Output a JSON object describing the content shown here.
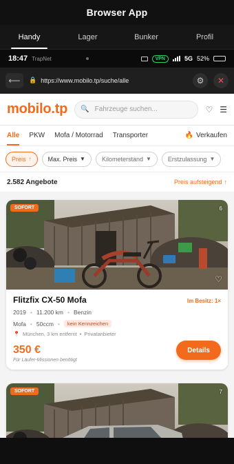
{
  "app": {
    "title": "Browser App",
    "tabs": [
      "Handy",
      "Lager",
      "Bunker",
      "Profil"
    ]
  },
  "status": {
    "time": "18:47",
    "carrier": "TrapNet",
    "vpn": "VPN",
    "network": "5G",
    "battery": "52%",
    "battery_level": 0.52
  },
  "browser": {
    "url": "https://www.mobilo.tp/suche/alle"
  },
  "site": {
    "logo": "mobilo",
    "logo_tld": ".tp",
    "search_placeholder": "Fahrzeuge suchen...",
    "categories": [
      "Alle",
      "PKW",
      "Mofa / Motorrad",
      "Transporter",
      "Verkaufen"
    ],
    "filters": [
      "Preis",
      "Max. Preis",
      "Kilometerstand",
      "Erstzulassung"
    ],
    "result_count": "2.582 Angebote",
    "sort_label": "Preis aufsteigend",
    "listings": [
      {
        "badge": "SOFORT",
        "photo_count": "6",
        "title": "Flitzfix CX-50 Mofa",
        "ownership": "Im Besitz: 1×",
        "year": "2019",
        "mileage": "11.200 km",
        "fuel": "Benzin",
        "type": "Mofa",
        "engine": "50ccm",
        "tag": "kein Kennzeichen",
        "location": "München, 3 km entfernt",
        "seller": "Privatanbieter",
        "price": "350 €",
        "price_note": "Für Läufer-Missionen benötigt",
        "details_label": "Details"
      },
      {
        "badge": "SOFORT",
        "photo_count": "7"
      }
    ]
  },
  "colors": {
    "accent": "#f26b1d",
    "vpn": "#2bd16b",
    "close": "#ff4a5c"
  }
}
